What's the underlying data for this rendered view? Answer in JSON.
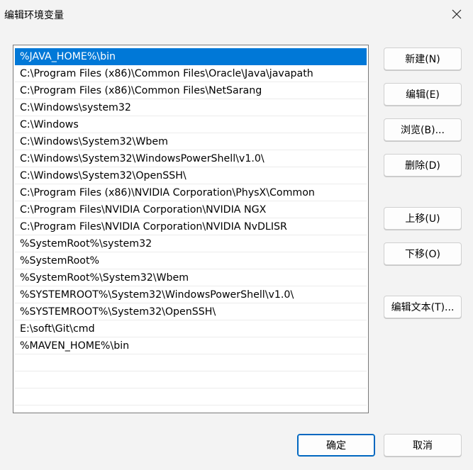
{
  "window": {
    "title": "编辑环境变量"
  },
  "paths": [
    "%JAVA_HOME%\\bin",
    "C:\\Program Files (x86)\\Common Files\\Oracle\\Java\\javapath",
    "C:\\Program Files (x86)\\Common Files\\NetSarang",
    "C:\\Windows\\system32",
    "C:\\Windows",
    "C:\\Windows\\System32\\Wbem",
    "C:\\Windows\\System32\\WindowsPowerShell\\v1.0\\",
    "C:\\Windows\\System32\\OpenSSH\\",
    "C:\\Program Files (x86)\\NVIDIA Corporation\\PhysX\\Common",
    "C:\\Program Files\\NVIDIA Corporation\\NVIDIA NGX",
    "C:\\Program Files\\NVIDIA Corporation\\NVIDIA NvDLISR",
    "%SystemRoot%\\system32",
    "%SystemRoot%",
    "%SystemRoot%\\System32\\Wbem",
    "%SYSTEMROOT%\\System32\\WindowsPowerShell\\v1.0\\",
    "%SYSTEMROOT%\\System32\\OpenSSH\\",
    "E:\\soft\\Git\\cmd",
    "%MAVEN_HOME%\\bin"
  ],
  "selected_index": 0,
  "empty_rows": 3,
  "buttons": {
    "new": "新建(N)",
    "edit": "编辑(E)",
    "browse": "浏览(B)...",
    "delete": "删除(D)",
    "move_up": "上移(U)",
    "move_down": "下移(O)",
    "edit_text": "编辑文本(T)...",
    "ok": "确定",
    "cancel": "取消"
  },
  "icons": {
    "close": "close-icon"
  },
  "colors": {
    "selection": "#0078d7",
    "primary_border": "#0067c0"
  }
}
